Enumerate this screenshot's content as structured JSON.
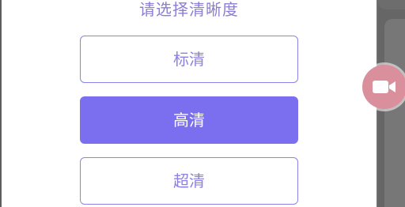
{
  "dialog": {
    "title": "请选择清晰度",
    "options": [
      {
        "label": "标清",
        "selected": false
      },
      {
        "label": "高清",
        "selected": true
      },
      {
        "label": "超清",
        "selected": false
      }
    ]
  },
  "floating_button": {
    "icon": "video-camera-icon"
  },
  "colors": {
    "accent": "#7b6ff0",
    "title_text": "#8a7ed6",
    "option_text": "#8b82e0",
    "floating_button_bg": "#d98f9c",
    "overlay_bg": "#6f6f6f"
  }
}
